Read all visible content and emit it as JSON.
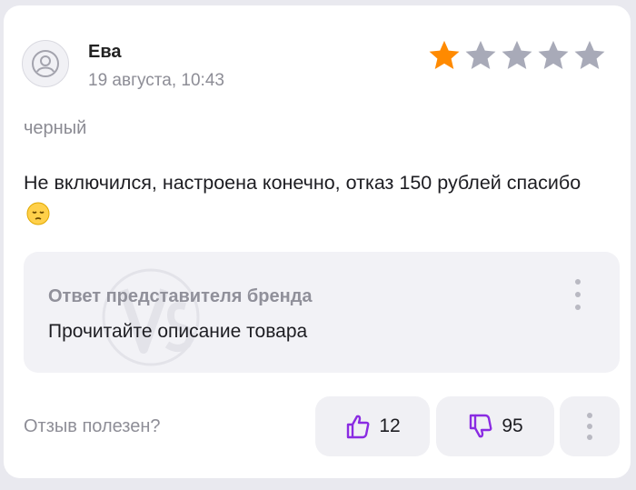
{
  "review": {
    "author": "Ева",
    "date": "19 августа, 10:43",
    "rating": 1,
    "rating_max": 5,
    "variant": "черный",
    "text": "Не включился, настроена конечно, отказ 150 рублей спасибо",
    "emoji_icon": "pensive-face-icon"
  },
  "brand_reply": {
    "title": "Ответ представителя бренда",
    "text": "Прочитайте описание товара"
  },
  "footer": {
    "helpful_label": "Отзыв полезен?",
    "likes": "12",
    "dislikes": "95"
  },
  "colors": {
    "star_active": "#ff8a00",
    "star_inactive": "#a8aab8",
    "vote_icon": "#8a2be2"
  }
}
